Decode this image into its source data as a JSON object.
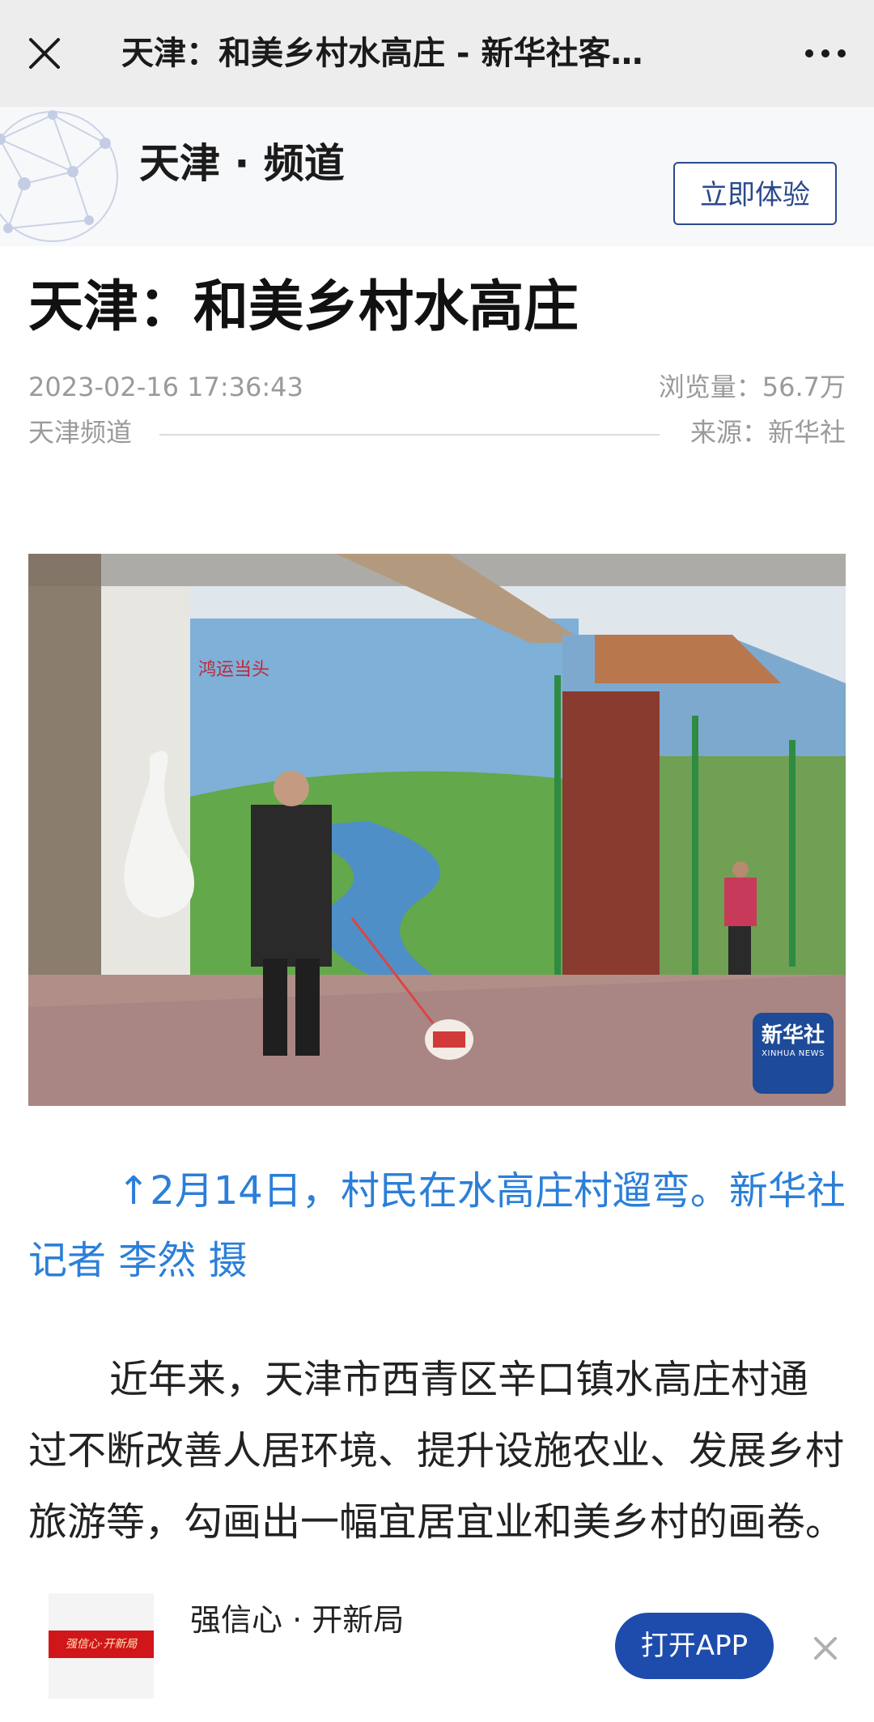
{
  "navbar": {
    "title": "天津：和美乡村水高庄 - 新华社客…",
    "close_icon": "close-icon",
    "more_icon": "more-dots-icon"
  },
  "banner": {
    "channel_title": "天津 · 频道",
    "try_button": "立即体验",
    "deco_icon": "network-globe-icon"
  },
  "article": {
    "title": "天津：和美乡村水高庄",
    "date": "2023-02-16 17:36:43",
    "views": "浏览量：56.7万",
    "channel": "天津频道",
    "source": "来源：新华社"
  },
  "photo": {
    "mural_text": "鸿运当头",
    "badge_title": "新华社",
    "badge_subtitle": "XINHUA NEWS"
  },
  "caption": "↑2月14日，村民在水高庄村遛弯。新华社记者 李然 摄",
  "body": "近年来，天津市西青区辛口镇水高庄村通过不断改善人居环境、提升设施农业、发展乡村旅游等，勾画出一幅宜居宜业和美乡村的画卷。",
  "bottom_bar": {
    "thumb_text": "强信心·开新局",
    "title": "强信心 · 开新局",
    "open_app": "打开APP",
    "close_icon": "close-icon"
  },
  "colors": {
    "accent_blue": "#2b7fd8",
    "brand_navy": "#1d4cad",
    "button_border": "#2a4a8c"
  }
}
